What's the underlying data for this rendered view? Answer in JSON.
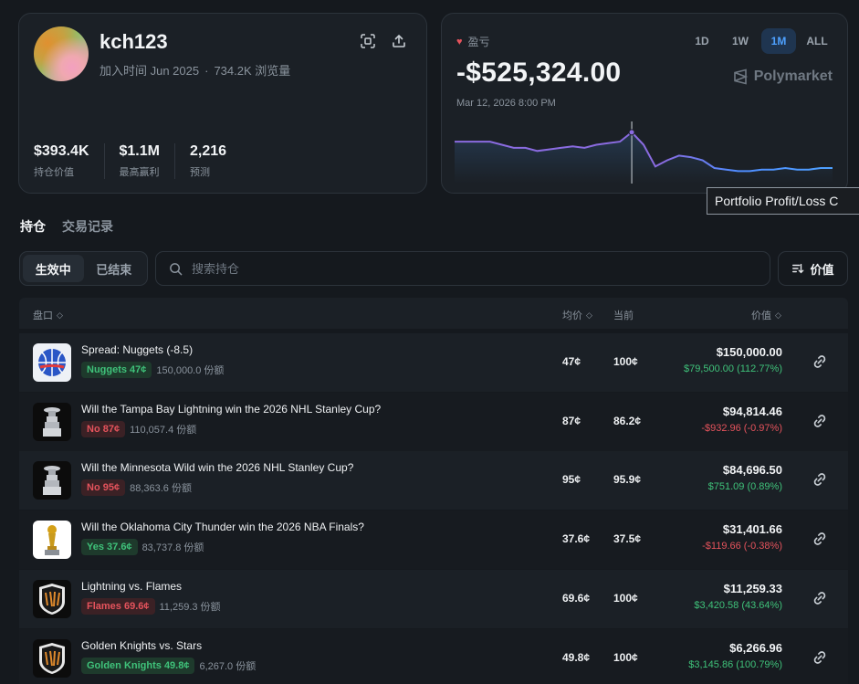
{
  "profile": {
    "username": "kch123",
    "joined": "加入时间 Jun 2025",
    "views": "734.2K 浏览量",
    "stats": [
      {
        "value": "$393.4K",
        "label": "持仓价值"
      },
      {
        "value": "$1.1M",
        "label": "最高赢利"
      },
      {
        "value": "2,216",
        "label": "预测"
      }
    ]
  },
  "pnl": {
    "label": "盈亏",
    "value": "-$525,324.00",
    "date": "Mar 12, 2026 8:00 PM",
    "periods": [
      "1D",
      "1W",
      "1M",
      "ALL"
    ],
    "active_period": "1M",
    "brand": "Polymarket",
    "accent_color": "#4ea1ff",
    "spark_series": [
      62,
      62,
      62,
      62,
      60,
      58,
      58,
      56,
      57,
      58,
      59,
      58,
      60,
      61,
      62,
      68,
      60,
      46,
      50,
      53,
      52,
      50,
      45,
      44,
      43,
      43,
      44,
      44,
      45,
      44,
      44,
      45,
      45
    ]
  },
  "tooltip": "Portfolio Profit/Loss C",
  "tabs": [
    "持仓",
    "交易记录"
  ],
  "filter": {
    "segments": [
      "生效中",
      "已结束"
    ],
    "search_placeholder": "搜索持仓",
    "sort_label": "价值"
  },
  "table": {
    "headers": {
      "market": "盘口",
      "avg": "均价",
      "current": "当前",
      "value": "价值"
    },
    "rows": [
      {
        "title": "Spread: Nuggets (-8.5)",
        "outcome": "Nuggets 47¢",
        "outcome_color": "green",
        "shares": "150,000.0 份额",
        "avg": "47¢",
        "current": "100¢",
        "value": "$150,000.00",
        "change": "$79,500.00 (112.77%)",
        "change_dir": "pos",
        "icon": "basketball-icon"
      },
      {
        "title": "Will the Tampa Bay Lightning win the 2026 NHL Stanley Cup?",
        "outcome": "No 87¢",
        "outcome_color": "red",
        "shares": "110,057.4 份额",
        "avg": "87¢",
        "current": "86.2¢",
        "value": "$94,814.46",
        "change": "-$932.96 (-0.97%)",
        "change_dir": "neg",
        "icon": "stanley-cup-icon"
      },
      {
        "title": "Will the Minnesota Wild win the 2026 NHL Stanley Cup?",
        "outcome": "No 95¢",
        "outcome_color": "red",
        "shares": "88,363.6 份额",
        "avg": "95¢",
        "current": "95.9¢",
        "value": "$84,696.50",
        "change": "$751.09 (0.89%)",
        "change_dir": "pos",
        "icon": "stanley-cup-icon"
      },
      {
        "title": "Will the Oklahoma City Thunder win the 2026 NBA Finals?",
        "outcome": "Yes 37.6¢",
        "outcome_color": "green",
        "shares": "83,737.8 份额",
        "avg": "37.6¢",
        "current": "37.5¢",
        "value": "$31,401.66",
        "change": "-$119.66 (-0.38%)",
        "change_dir": "neg",
        "icon": "nba-trophy-icon"
      },
      {
        "title": "Lightning vs. Flames",
        "outcome": "Flames 69.6¢",
        "outcome_color": "red",
        "shares": "11,259.3 份额",
        "avg": "69.6¢",
        "current": "100¢",
        "value": "$11,259.33",
        "change": "$3,420.58 (43.64%)",
        "change_dir": "pos",
        "icon": "nhl-logo-icon"
      },
      {
        "title": "Golden Knights vs. Stars",
        "outcome": "Golden Knights 49.8¢",
        "outcome_color": "green",
        "shares": "6,267.0 份额",
        "avg": "49.8¢",
        "current": "100¢",
        "value": "$6,266.96",
        "change": "$3,145.86 (100.79%)",
        "change_dir": "pos",
        "icon": "nhl-logo-icon"
      }
    ]
  }
}
